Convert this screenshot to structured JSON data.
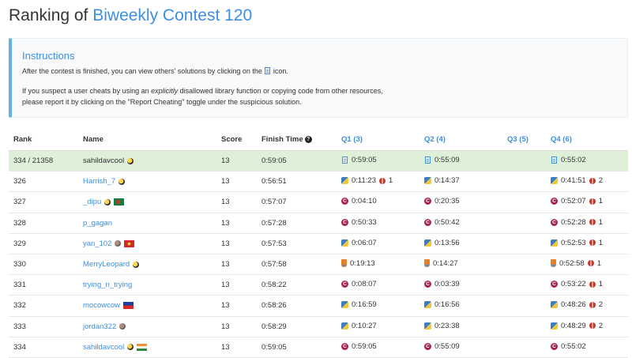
{
  "page": {
    "title_prefix": "Ranking of ",
    "contest_name": "Biweekly Contest 120"
  },
  "instructions": {
    "title": "Instructions",
    "p1_before": "After the contest is finished, you can view others' solutions by clicking on the",
    "p1_after": "icon.",
    "p2_before": "If you suspect a user cheats by using an ",
    "p2_em": "explicitly",
    "p2_after": " disallowed library function or copying code from other resources,",
    "p3": "please report it by clicking on the \"Report Cheating\" toggle under the suspicious solution."
  },
  "table": {
    "headers": {
      "rank": "Rank",
      "name": "Name",
      "score": "Score",
      "finish_time": "Finish Time",
      "q1": "Q1 (3)",
      "q2": "Q2 (4)",
      "q3": "Q3 (5)",
      "q4": "Q4 (6)"
    },
    "rows": [
      {
        "rank": "334 / 21358",
        "name": "sahildavcool",
        "score": "13",
        "finish": "0:59:05",
        "q1": {
          "time": "0:59:05",
          "lang": "doc"
        },
        "q2": {
          "time": "0:55:09",
          "lang": "doc"
        },
        "q3": null,
        "q4": {
          "time": "0:55:02",
          "lang": "doc"
        },
        "badge": "knight",
        "flag": null,
        "current_user": true
      },
      {
        "rank": "326",
        "name": "Harrish_7",
        "score": "13",
        "finish": "0:56:51",
        "q1": {
          "time": "0:11:23",
          "lang": "python",
          "bugs": "1"
        },
        "q2": {
          "time": "0:14:37",
          "lang": "python"
        },
        "q3": null,
        "q4": {
          "time": "0:41:51",
          "lang": "python",
          "bugs": "2"
        },
        "badge": "knight",
        "flag": null
      },
      {
        "rank": "327",
        "name": "_dipu",
        "score": "13",
        "finish": "0:57:07",
        "q1": {
          "time": "0:04:10",
          "lang": "cpp"
        },
        "q2": {
          "time": "0:20:35",
          "lang": "cpp"
        },
        "q3": null,
        "q4": {
          "time": "0:52:07",
          "lang": "cpp",
          "bugs": "1"
        },
        "badge": "knight",
        "flag": "bd"
      },
      {
        "rank": "328",
        "name": "p_gagan",
        "score": "13",
        "finish": "0:57:28",
        "q1": {
          "time": "0:50:33",
          "lang": "cpp"
        },
        "q2": {
          "time": "0:50:42",
          "lang": "cpp"
        },
        "q3": null,
        "q4": {
          "time": "0:52:28",
          "lang": "cpp",
          "bugs": "1"
        },
        "badge": null,
        "flag": null
      },
      {
        "rank": "329",
        "name": "yan_102",
        "score": "13",
        "finish": "0:57:53",
        "q1": {
          "time": "0:06:07",
          "lang": "python"
        },
        "q2": {
          "time": "0:13:56",
          "lang": "python"
        },
        "q3": null,
        "q4": {
          "time": "0:52:53",
          "lang": "python",
          "bugs": "1"
        },
        "badge": "guardian",
        "flag": "vn"
      },
      {
        "rank": "330",
        "name": "MerryLeopard",
        "score": "13",
        "finish": "0:57:58",
        "q1": {
          "time": "0:19:13",
          "lang": "java"
        },
        "q2": {
          "time": "0:14:27",
          "lang": "java"
        },
        "q3": null,
        "q4": {
          "time": "0:52:58",
          "lang": "java",
          "bugs": "1"
        },
        "badge": "knight",
        "flag": null
      },
      {
        "rank": "331",
        "name": "trying_n_trying",
        "score": "13",
        "finish": "0:58:22",
        "q1": {
          "time": "0:08:07",
          "lang": "cpp"
        },
        "q2": {
          "time": "0:03:39",
          "lang": "cpp"
        },
        "q3": null,
        "q4": {
          "time": "0:53:22",
          "lang": "cpp",
          "bugs": "1"
        },
        "badge": null,
        "flag": null
      },
      {
        "rank": "332",
        "name": "mocowcow",
        "score": "13",
        "finish": "0:58:26",
        "q1": {
          "time": "0:16:59",
          "lang": "python"
        },
        "q2": {
          "time": "0:16:56",
          "lang": "python"
        },
        "q3": null,
        "q4": {
          "time": "0:48:26",
          "lang": "python",
          "bugs": "2"
        },
        "badge": null,
        "flag": "tw"
      },
      {
        "rank": "333",
        "name": "jordan322",
        "score": "13",
        "finish": "0:58:29",
        "q1": {
          "time": "0:10:27",
          "lang": "python"
        },
        "q2": {
          "time": "0:23:38",
          "lang": "python"
        },
        "q3": null,
        "q4": {
          "time": "0:48:29",
          "lang": "python",
          "bugs": "2"
        },
        "badge": "guardian",
        "flag": null
      },
      {
        "rank": "334",
        "name": "sahildavcool",
        "score": "13",
        "finish": "0:59:05",
        "q1": {
          "time": "0:59:05",
          "lang": "cpp"
        },
        "q2": {
          "time": "0:55:09",
          "lang": "cpp"
        },
        "q3": null,
        "q4": {
          "time": "0:55:02",
          "lang": "cpp"
        },
        "badge": "knight",
        "flag": "in"
      }
    ]
  },
  "colors": {
    "accent": "#3d8ee0",
    "highlight_row": "#dff0d8",
    "instructions_border": "#61b2e8"
  }
}
